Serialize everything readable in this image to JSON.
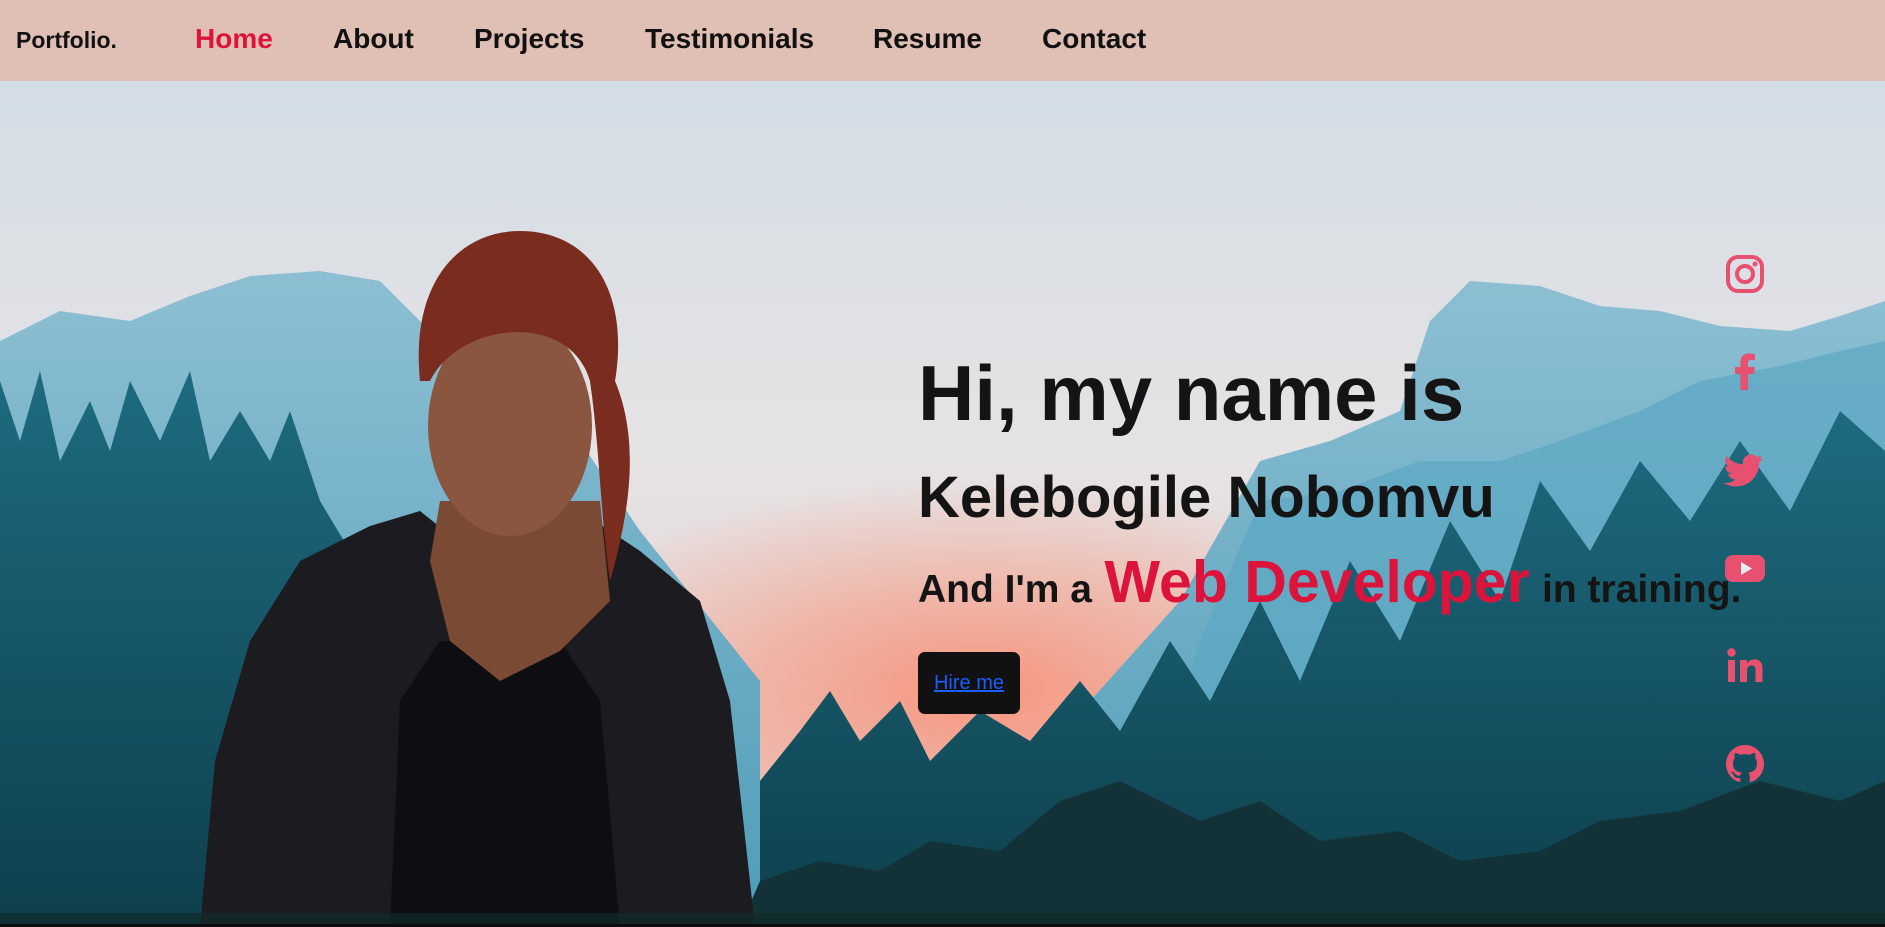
{
  "header": {
    "logo": "Portfolio.",
    "nav": [
      {
        "label": "Home",
        "active": true
      },
      {
        "label": "About",
        "active": false
      },
      {
        "label": "Projects",
        "active": false
      },
      {
        "label": "Testimonials",
        "active": false
      },
      {
        "label": "Resume",
        "active": false
      },
      {
        "label": "Contact",
        "active": false
      }
    ]
  },
  "hero": {
    "greeting": "Hi, my name is",
    "name": "Kelebogile Nobomvu",
    "role_prefix": "And I'm a",
    "role": "Web Developer",
    "role_suffix": "in training.",
    "cta_label": "Hire me"
  },
  "social": [
    "instagram-icon",
    "facebook-icon",
    "twitter-icon",
    "youtube-icon",
    "linkedin-icon",
    "github-icon"
  ],
  "colors": {
    "accent": "#dc143c",
    "nav_bg": "#e0bfb5",
    "icon": "#e8506f",
    "button_bg": "#111111",
    "link": "#1a5cff"
  }
}
